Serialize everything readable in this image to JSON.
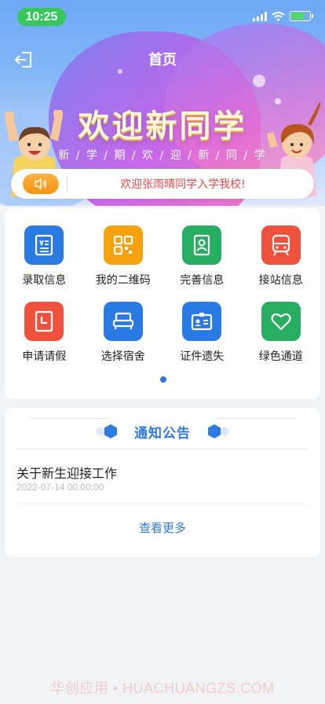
{
  "status_bar": {
    "time": "10:25"
  },
  "nav": {
    "title": "首页",
    "back_icon": "exit-icon"
  },
  "banner": {
    "title": "欢迎新同学",
    "subtitle": "新 / 学 / 期 / 欢 / 迎 / 新 / 同 / 学"
  },
  "notice_bar": {
    "icon": "speaker-icon",
    "text": "欢迎张雨晴同学入学我校!"
  },
  "grid": {
    "items": [
      {
        "label": "录取信息",
        "icon": "admission-card-icon",
        "color": "#2a7ae4"
      },
      {
        "label": "我的二维码",
        "icon": "qr-code-icon",
        "color": "#f5a20e"
      },
      {
        "label": "完善信息",
        "icon": "profile-edit-icon",
        "color": "#27ae60"
      },
      {
        "label": "接站信息",
        "icon": "train-icon",
        "color": "#f0513d"
      },
      {
        "label": "申请请假",
        "icon": "leave-clock-icon",
        "color": "#f0513d"
      },
      {
        "label": "选择宿舍",
        "icon": "bed-icon",
        "color": "#2a7ae4"
      },
      {
        "label": "证件遗失",
        "icon": "id-card-icon",
        "color": "#2a7ae4"
      },
      {
        "label": "绿色通道",
        "icon": "heart-icon",
        "color": "#27ae60"
      }
    ]
  },
  "announcements": {
    "title": "通知公告",
    "items": [
      {
        "title": "关于新生迎接工作",
        "date": "2022-07-14 00:00:00"
      }
    ],
    "more_label": "查看更多"
  },
  "watermark": "华创应用 • HUACHUANGZS.COM",
  "colors": {
    "accent": "#2e7ae3",
    "notice_text": "#ea4b4b",
    "status_green": "#35c759"
  }
}
